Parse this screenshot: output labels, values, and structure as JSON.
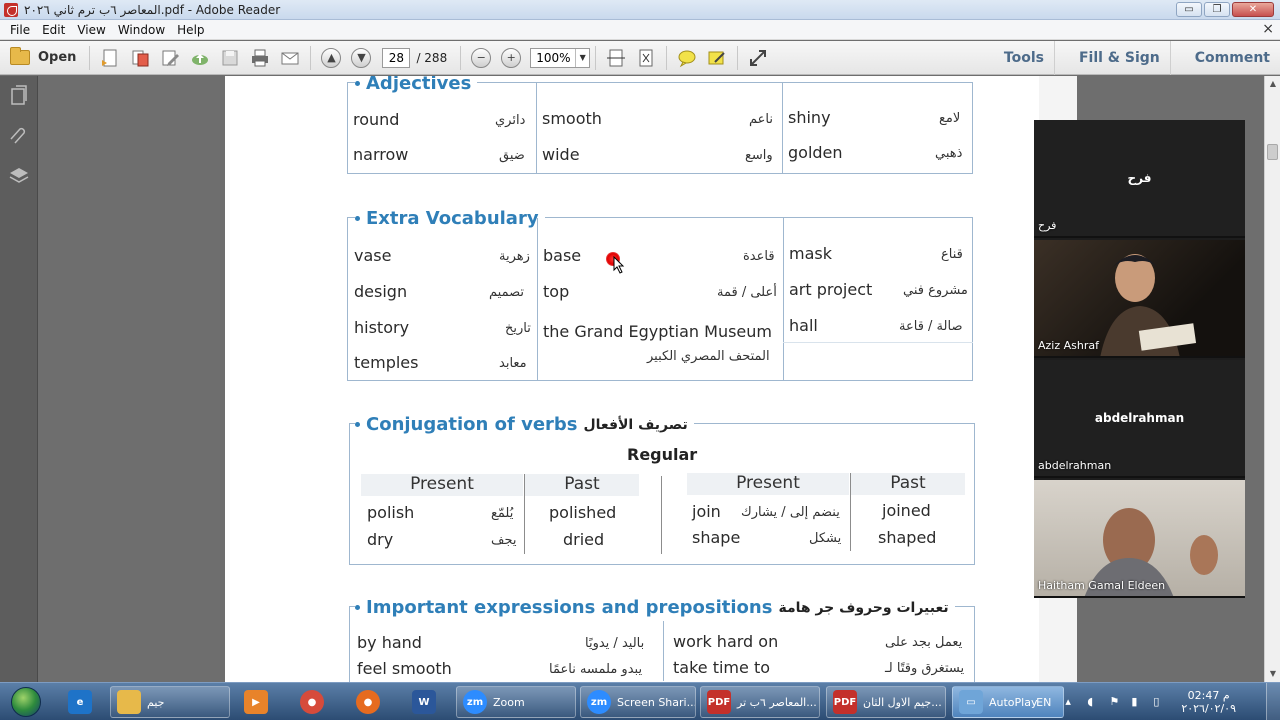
{
  "window": {
    "title": "المعاصر ٦ب ترم ثاني ٢٠٢٦.pdf - Adobe Reader",
    "minimize": "▭",
    "restore": "❐",
    "close": "✕"
  },
  "menu": {
    "items": [
      "File",
      "Edit",
      "View",
      "Window",
      "Help"
    ],
    "close": "×"
  },
  "toolbar": {
    "open_label": "Open",
    "page_current": "28",
    "page_total": "/ 288",
    "zoom": "100%",
    "tools": "Tools",
    "fill_sign": "Fill & Sign",
    "comment": "Comment"
  },
  "document": {
    "adjectives": {
      "title": "Adjectives",
      "rows": [
        [
          {
            "en": "round",
            "ar": "دائري"
          },
          {
            "en": "smooth",
            "ar": "ناعم"
          },
          {
            "en": "shiny",
            "ar": "لامع"
          }
        ],
        [
          {
            "en": "narrow",
            "ar": "ضيق"
          },
          {
            "en": "wide",
            "ar": "واسع"
          },
          {
            "en": "golden",
            "ar": "ذهبي"
          }
        ]
      ]
    },
    "extra": {
      "title": "Extra Vocabulary",
      "col1": [
        {
          "en": "vase",
          "ar": "زهرية"
        },
        {
          "en": "design",
          "ar": "تصميم"
        },
        {
          "en": "history",
          "ar": "تاريخ"
        },
        {
          "en": "temples",
          "ar": "معابد"
        }
      ],
      "col2": [
        {
          "en": "base",
          "ar": "قاعدة"
        },
        {
          "en": "top",
          "ar": "أعلى / قمة"
        },
        {
          "en": "the Grand Egyptian Museum",
          "ar": "المتحف المصري الكبير"
        }
      ],
      "col3": [
        {
          "en": "mask",
          "ar": "قناع"
        },
        {
          "en": "art project",
          "ar": "مشروع فني"
        },
        {
          "en": "hall",
          "ar": "صالة / قاعة"
        }
      ]
    },
    "conjugation": {
      "title": "Conjugation of verbs",
      "title_ar": "تصريف الأفعال",
      "subtitle": "Regular",
      "h_present": "Present",
      "h_past": "Past",
      "left": [
        {
          "present": "polish",
          "ar": "يُلمّع",
          "past": "polished"
        },
        {
          "present": "dry",
          "ar": "يجف",
          "past": "dried"
        }
      ],
      "right": [
        {
          "present": "join",
          "ar": "ينضم إلى / يشارك",
          "past": "joined"
        },
        {
          "present": "shape",
          "ar": "يشكل",
          "past": "shaped"
        }
      ]
    },
    "expressions": {
      "title": "Important expressions and prepositions",
      "title_ar": "تعبيرات وحروف جر هامة",
      "rows": [
        [
          {
            "en": "by hand",
            "ar": "باليد / يدويًا"
          },
          {
            "en": "work hard on",
            "ar": "يعمل بجد على"
          }
        ],
        [
          {
            "en": "feel smooth",
            "ar": "يبدو ملمسه ناعمًا"
          },
          {
            "en": "take time to",
            "ar": "يستغرق وقتًا لـ"
          }
        ]
      ]
    }
  },
  "participants": [
    {
      "center": "فرح",
      "label": "فرح"
    },
    {
      "center": "",
      "label": "Aziz Ashraf"
    },
    {
      "center": "abdelrahman",
      "label": "abdelrahman"
    },
    {
      "center": "",
      "label": "Haitham Gamal Eldeen"
    }
  ],
  "taskbar": {
    "items": [
      {
        "label": "جيم",
        "color": "#e7b94a",
        "icon": "folder-icon"
      },
      {
        "label": "Zoom",
        "color": "#2d8cff",
        "icon": "zoom-icon"
      },
      {
        "label": "Screen Shari...",
        "color": "#2d8cff",
        "icon": "zoom-share-icon"
      },
      {
        "label": "المعاصر ٦ب تر...",
        "color": "#c4302b",
        "icon": "pdf-icon"
      },
      {
        "label": "جيم الاول الثان...",
        "color": "#c4302b",
        "icon": "pdf-icon"
      },
      {
        "label": "AutoPlay",
        "color": "#6fa5d8",
        "icon": "autoplay-icon"
      }
    ],
    "lang": "EN",
    "time": "02:47 م",
    "date": "٢٠٢٦/٠٢/٠٩"
  }
}
